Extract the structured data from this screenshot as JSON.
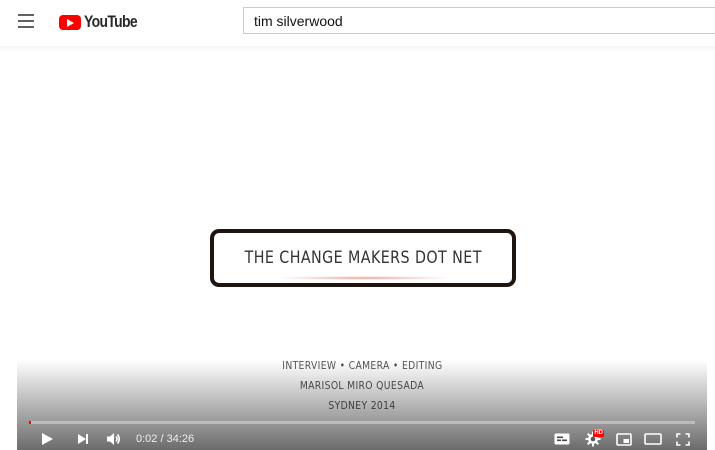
{
  "masthead": {
    "menu_icon": "hamburger-menu-icon",
    "logo_text": "YouTube",
    "brand_color": "#ff0000",
    "search": {
      "value": "tim silverwood"
    }
  },
  "video": {
    "title_card": "THE CHANGE MAKERS DOT NET",
    "credits": [
      "INTERVIEW • CAMERA • EDITING",
      "MARISOL MIRO QUESADA",
      "SYDNEY 2014"
    ]
  },
  "player_controls": {
    "current_time": "0:02",
    "time_separator": " / ",
    "duration": "34:26",
    "progress_fraction": 0.001,
    "hd_badge": "HD",
    "icons": {
      "play": "play-icon",
      "next": "next-icon",
      "volume": "volume-icon",
      "subtitles": "subtitles-icon",
      "settings": "settings-gear-icon",
      "miniplayer": "miniplayer-icon",
      "theater": "theater-mode-icon",
      "fullscreen": "fullscreen-icon"
    }
  }
}
